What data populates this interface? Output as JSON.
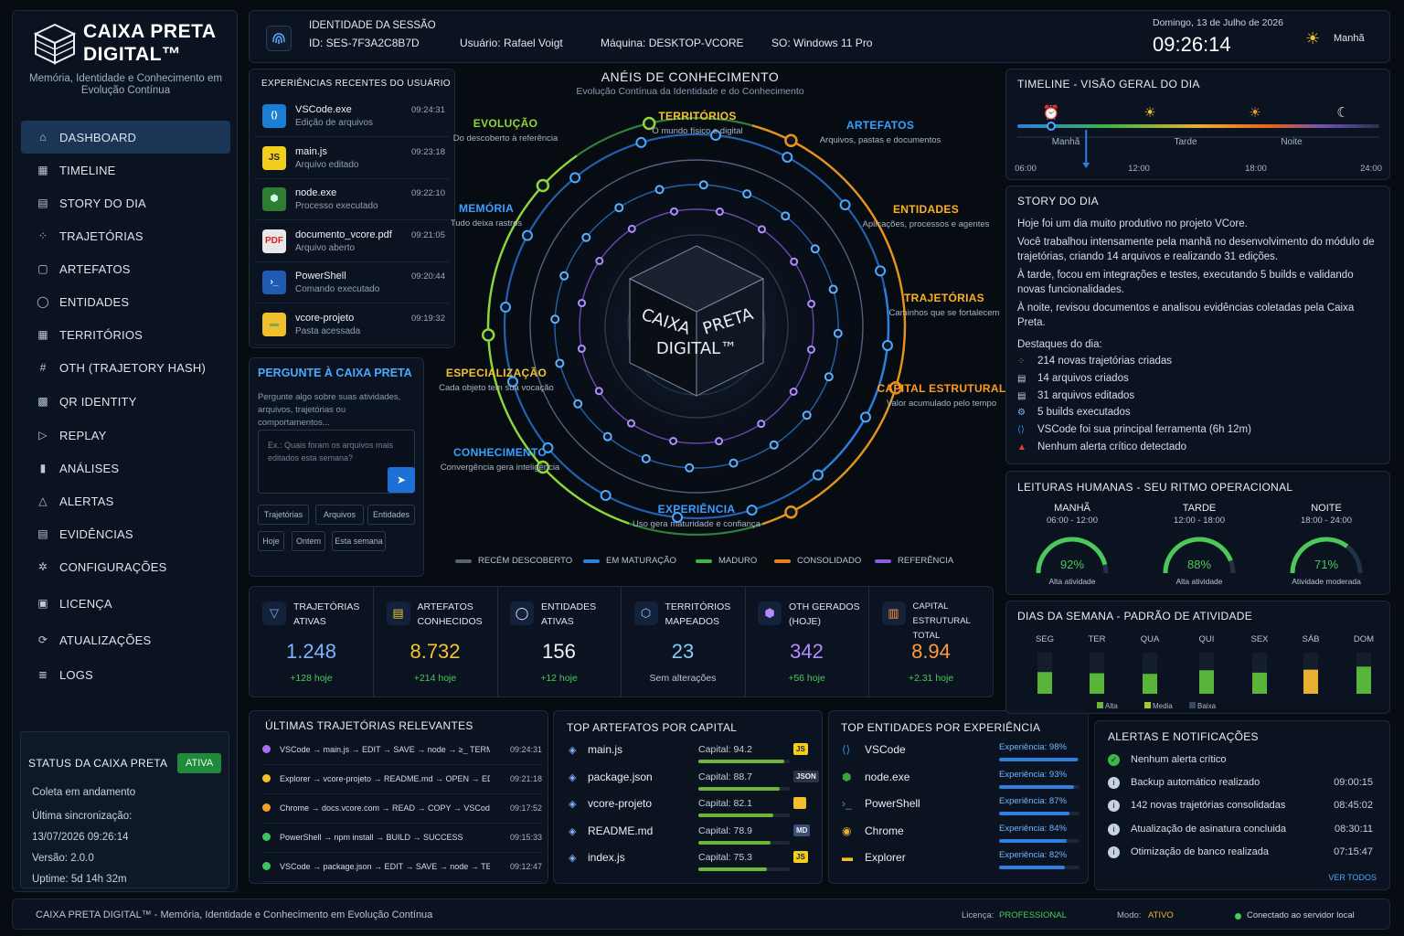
{
  "brand": {
    "line1": "CAIXA PRETA",
    "line2": "DIGITAL™",
    "tagline": "Memória, Identidade e Conhecimento em Evolução Contínua"
  },
  "sidebar": {
    "items": [
      {
        "label": "DASHBOARD",
        "icon": "home-icon",
        "active": true
      },
      {
        "label": "TIMELINE",
        "icon": "calendar-icon"
      },
      {
        "label": "STORY DO DIA",
        "icon": "book-icon"
      },
      {
        "label": "TRAJETÓRIAS",
        "icon": "graph-icon"
      },
      {
        "label": "ARTEFATOS",
        "icon": "file-icon"
      },
      {
        "label": "ENTIDADES",
        "icon": "user-icon"
      },
      {
        "label": "TERRITÓRIOS",
        "icon": "map-icon"
      },
      {
        "label": "OTH (TRAJETORY HASH)",
        "icon": "hash-icon"
      },
      {
        "label": "QR IDENTITY",
        "icon": "qr-icon"
      },
      {
        "label": "REPLAY",
        "icon": "play-icon"
      },
      {
        "label": "ANÁLISES",
        "icon": "chart-icon"
      },
      {
        "label": "ALERTAS",
        "icon": "bell-icon"
      },
      {
        "label": "EVIDÊNCIAS",
        "icon": "doc-icon"
      },
      {
        "label": "CONFIGURAÇÕES",
        "icon": "gear-icon"
      },
      {
        "label": "LICENÇA",
        "icon": "license-icon"
      },
      {
        "label": "ATUALIZAÇÕES",
        "icon": "update-icon"
      },
      {
        "label": "LOGS",
        "icon": "log-icon"
      }
    ],
    "status": {
      "title": "STATUS DA CAIXA PRETA",
      "badge": "ATIVA",
      "line1": "Coleta em andamento",
      "line2": "Última sincronização:",
      "line3": "13/07/2026 09:26:14",
      "line4": "Versão: 2.0.0",
      "line5": "Uptime: 5d 14h 32m"
    }
  },
  "header": {
    "session_label": "IDENTIDADE DA SESSÃO",
    "session_id": "ID: SES-7F3A2C8B7D",
    "user": "Usuário: Rafael Voigt",
    "machine": "Máquina: DESKTOP-VCORE",
    "os": "SO: Windows 11 Pro",
    "date": "Domingo, 13 de Julho de 2026",
    "time": "09:26:14",
    "period": "Manhã"
  },
  "recent": {
    "title": "EXPERIÊNCIAS RECENTES DO USUÁRIO",
    "items": [
      {
        "name": "VSCode.exe",
        "sub": "Edição de arquivos",
        "time": "09:24:31",
        "icon": "vscode-icon"
      },
      {
        "name": "main.js",
        "sub": "Arquivo editado",
        "time": "09:23:18",
        "icon": "js-file-icon"
      },
      {
        "name": "node.exe",
        "sub": "Processo executado",
        "time": "09:22:10",
        "icon": "node-icon"
      },
      {
        "name": "documento_vcore.pdf",
        "sub": "Arquivo aberto",
        "time": "09:21:05",
        "icon": "pdf-icon"
      },
      {
        "name": "PowerShell",
        "sub": "Comando executado",
        "time": "09:20:44",
        "icon": "powershell-icon"
      },
      {
        "name": "vcore-projeto",
        "sub": "Pasta acessada",
        "time": "09:19:32",
        "icon": "folder-icon"
      }
    ]
  },
  "ask": {
    "title": "PERGUNTE À CAIXA PRETA",
    "desc": "Pergunte algo sobre suas atividades, arquivos, trajetórias ou comportamentos...",
    "placeholder": "Ex.: Quais foram os arquivos mais editados esta semana?",
    "chips": [
      "Trajetórias",
      "Arquivos",
      "Entidades",
      "Hoje",
      "Ontem",
      "Esta semana"
    ]
  },
  "rings": {
    "title": "ANÉIS DE CONHECIMENTO",
    "subtitle": "Evolução Contínua da Identidade e do Conhecimento",
    "cube_text": [
      "CAIXA",
      "PRETA",
      "DIGITAL™"
    ],
    "labels": [
      {
        "title": "TERRITÓRIOS",
        "desc": "O mundo físico e digital",
        "color": "#f2c230"
      },
      {
        "title": "ARTEFATOS",
        "desc": "Arquivos, pastas e documentos",
        "color": "#3aa0ff"
      },
      {
        "title": "ENTIDADES",
        "desc": "Aplicações, processos e agentes",
        "color": "#ffb020"
      },
      {
        "title": "TRAJETÓRIAS",
        "desc": "Caminhos que se fortalecem",
        "color": "#ffb020"
      },
      {
        "title": "CAPITAL ESTRUTURAL",
        "desc": "Valor acumulado pelo tempo",
        "color": "#ff9a1f"
      },
      {
        "title": "EXPERIÊNCIA",
        "desc": "Uso gera maturidade e confiança",
        "color": "#3aa0ff"
      },
      {
        "title": "CONHECIMENTO",
        "desc": "Convergência gera inteligência",
        "color": "#3aa0ff"
      },
      {
        "title": "ESPECIALIZAÇÃO",
        "desc": "Cada objeto tem sua vocação",
        "color": "#f2c230"
      },
      {
        "title": "MEMÓRIA",
        "desc": "Tudo deixa rastros",
        "color": "#3aa0ff"
      },
      {
        "title": "EVOLUÇÃO",
        "desc": "Do descoberto à referência",
        "color": "#8ed63a"
      }
    ],
    "legend": [
      {
        "label": "RECÉM DESCOBERTO",
        "color": "#5a6372"
      },
      {
        "label": "EM MATURAÇÃO",
        "color": "#2d7fe0"
      },
      {
        "label": "MADURO",
        "color": "#3cb54a"
      },
      {
        "label": "CONSOLIDADO",
        "color": "#e8821c"
      },
      {
        "label": "REFERÊNCIA",
        "color": "#8c5ce0"
      }
    ]
  },
  "stats": [
    {
      "l1": "TRAJETÓRIAS",
      "l2": "ATIVAS",
      "value": "1.248",
      "change": "+128 hoje",
      "color": "#7fb3ff",
      "icon": "filter-icon"
    },
    {
      "l1": "ARTEFATOS",
      "l2": "CONHECIDOS",
      "value": "8.732",
      "change": "+214 hoje",
      "color": "#f3c231",
      "icon": "file-stack-icon"
    },
    {
      "l1": "ENTIDADES",
      "l2": "ATIVAS",
      "value": "156",
      "change": "+12 hoje",
      "color": "#eef3f9",
      "icon": "user-icon"
    },
    {
      "l1": "TERRITÓRIOS",
      "l2": "MAPEADOS",
      "value": "23",
      "change": "Sem alterações",
      "color": "#7fd0ff",
      "icon": "cube-icon"
    },
    {
      "l1": "OTH GERADOS",
      "l2": "(HOJE)",
      "value": "342",
      "change": "+56 hoje",
      "color": "#b28cff",
      "icon": "hex-icon"
    },
    {
      "l1": "CAPITAL ESTRUTURAL",
      "l2": "TOTAL",
      "value": "8.94",
      "change": "+2.31 hoje",
      "color": "#ff9a3c",
      "icon": "capital-icon"
    }
  ],
  "trajectories": {
    "title": "ÚLTIMAS TRAJETÓRIAS RELEVANTES",
    "items": [
      {
        "path": "VSCode → main.js → EDIT → SAVE → node → ≥_ TERMINAL",
        "time": "09:24:31",
        "color": "#a86cf5"
      },
      {
        "path": "Explorer → vcore-projeto → README.md → OPEN → EDIT → E",
        "time": "09:21:18",
        "color": "#f2c230"
      },
      {
        "path": "Chrome → docs.vcore.com → READ → COPY → VSCode",
        "time": "09:17:52",
        "color": "#f2a030"
      },
      {
        "path": "PowerShell → npm install → BUILD → SUCCESS",
        "time": "09:15:33",
        "color": "#3cc45a"
      },
      {
        "path": "VSCode → package.json → EDIT → SAVE → node → TEST",
        "time": "09:12:47",
        "color": "#3cc45a"
      }
    ]
  },
  "artifacts": {
    "title": "TOP ARTEFATOS POR CAPITAL",
    "items": [
      {
        "name": "main.js",
        "capital": "Capital: 94.2",
        "pct": 0.94,
        "tag": "JS"
      },
      {
        "name": "package.json",
        "capital": "Capital: 88.7",
        "pct": 0.89,
        "tag": "JSON"
      },
      {
        "name": "vcore-projeto",
        "capital": "Capital: 82.1",
        "pct": 0.82,
        "tag": "folder"
      },
      {
        "name": "README.md",
        "capital": "Capital: 78.9",
        "pct": 0.79,
        "tag": "MD"
      },
      {
        "name": "index.js",
        "capital": "Capital: 75.3",
        "pct": 0.75,
        "tag": "JS"
      }
    ]
  },
  "entities": {
    "title": "TOP ENTIDADES POR EXPERIÊNCIA",
    "items": [
      {
        "name": "VSCode",
        "exp": "Experiência: 98%",
        "pct": 0.98,
        "icon": "vscode-icon"
      },
      {
        "name": "node.exe",
        "exp": "Experiência: 93%",
        "pct": 0.93,
        "icon": "node-icon"
      },
      {
        "name": "PowerShell",
        "exp": "Experiência: 87%",
        "pct": 0.87,
        "icon": "powershell-icon"
      },
      {
        "name": "Chrome",
        "exp": "Experiência: 84%",
        "pct": 0.84,
        "icon": "chrome-icon"
      },
      {
        "name": "Explorer",
        "exp": "Experiência: 82%",
        "pct": 0.82,
        "icon": "folder-icon"
      }
    ]
  },
  "timeline": {
    "title": "TIMELINE - VISÃO GERAL DO DIA",
    "periods": [
      "Manhã",
      "Tarde",
      "Noite"
    ],
    "ticks": [
      "06:00",
      "12:00",
      "18:00",
      "24:00"
    ],
    "current_fraction": 0.19
  },
  "story": {
    "title": "STORY DO DIA",
    "p1": "Hoje foi um dia muito produtivo no projeto VCore.",
    "p2": "Você trabalhou intensamente pela manhã no desenvolvimento do módulo de trajetórias, criando 14 arquivos e realizando 31 edições.",
    "p3": "À tarde, focou em integrações e testes, executando 5 builds e validando novas funcionalidades.",
    "p4": "À noite, revisou documentos e analisou evidências coletadas pela Caixa Preta.",
    "highlights_title": "Destaques do dia:",
    "highlights": [
      {
        "text": "214 novas trajetórias criadas",
        "icon": "trajectory-icon"
      },
      {
        "text": "14 arquivos criados",
        "icon": "file-icon"
      },
      {
        "text": "31 arquivos editados",
        "icon": "file-icon"
      },
      {
        "text": "5 builds executados",
        "icon": "build-icon"
      },
      {
        "text": "VSCode foi sua principal ferramenta (6h 12m)",
        "icon": "vscode-icon"
      },
      {
        "text": "Nenhum alerta crítico detectado",
        "icon": "warning-icon"
      }
    ]
  },
  "readings": {
    "title": "LEITURAS HUMANAS - SEU RITMO OPERACIONAL",
    "items": [
      {
        "name": "MANHÃ",
        "range": "06:00 - 12:00",
        "value": "92%",
        "pct": 0.92,
        "label": "Alta atividade"
      },
      {
        "name": "TARDE",
        "range": "12:00 - 18:00",
        "value": "88%",
        "pct": 0.88,
        "label": "Alta atividade"
      },
      {
        "name": "NOITE",
        "range": "18:00 - 24:00",
        "value": "71%",
        "pct": 0.71,
        "label": "Atividade moderada"
      }
    ]
  },
  "weekdays": {
    "title": "DIAS DA SEMANA - PADRÃO DE ATIVIDADE",
    "days": [
      "SEG",
      "TER",
      "QUA",
      "QUI",
      "SEX",
      "SÁB",
      "DOM"
    ],
    "values": [
      0.72,
      0.68,
      0.66,
      0.78,
      0.7,
      0.8,
      0.9
    ],
    "colors": [
      "#59b53a",
      "#59b53a",
      "#59b53a",
      "#59b53a",
      "#59b53a",
      "#e8b030",
      "#59b53a"
    ],
    "legend": [
      "Alta",
      "Media",
      "Baixa"
    ]
  },
  "alerts": {
    "title": "ALERTAS E NOTIFICAÇÕES",
    "items": [
      {
        "text": "Nenhum alerta crítico",
        "time": "",
        "icon": "check-icon"
      },
      {
        "text": "Backup automático realizado",
        "time": "09:00:15",
        "icon": "info-icon"
      },
      {
        "text": "142 novas trajetórias consolidadas",
        "time": "08:45:02",
        "icon": "info-icon"
      },
      {
        "text": "Atualização de asinatura concluida",
        "time": "08:30:11",
        "icon": "info-icon"
      },
      {
        "text": "Otimização de banco realizada",
        "time": "07:15:47",
        "icon": "info-icon"
      }
    ],
    "see_all": "VER TODOS"
  },
  "footer": {
    "left": "CAIXA PRETA DIGITAL™ - Memória, Identidade e Conhecimento em Evolução Contínua",
    "license_label": "Licença:",
    "license_value": "PROFESSIONAL",
    "mode_label": "Modo:",
    "mode_value": "ATIVO",
    "connection": "Conectado ao servidor local"
  }
}
